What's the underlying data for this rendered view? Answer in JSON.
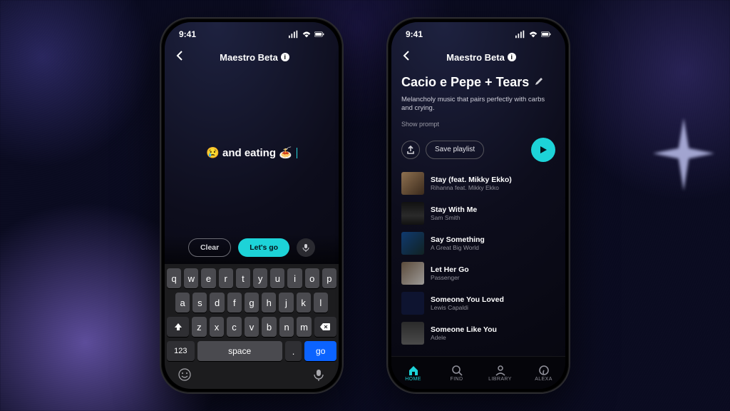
{
  "colors": {
    "accent": "#1dd3d8",
    "bg": "#0a0b20"
  },
  "statusbar": {
    "time": "9:41"
  },
  "nav": {
    "title": "Maestro Beta"
  },
  "phone1": {
    "prompt_text": "and eating",
    "actions": {
      "clear": "Clear",
      "go": "Let's go"
    },
    "keyboard": {
      "row1": [
        "q",
        "w",
        "e",
        "r",
        "t",
        "y",
        "u",
        "i",
        "o",
        "p"
      ],
      "row2": [
        "a",
        "s",
        "d",
        "f",
        "g",
        "h",
        "j",
        "k",
        "l"
      ],
      "row3": [
        "z",
        "x",
        "c",
        "v",
        "b",
        "n",
        "m"
      ],
      "num": "123",
      "space": "space",
      "return": "go"
    }
  },
  "phone2": {
    "playlist_title": "Cacio e Pepe + Tears",
    "playlist_desc": "Melancholy music that pairs perfectly with carbs and crying.",
    "show_prompt": "Show prompt",
    "save_label": "Save playlist",
    "tracks": [
      {
        "title": "Stay (feat. Mikky Ekko)",
        "artist": "Rihanna feat. Mikky Ekko"
      },
      {
        "title": "Stay With Me",
        "artist": "Sam Smith"
      },
      {
        "title": "Say Something",
        "artist": "A Great Big World"
      },
      {
        "title": "Let Her Go",
        "artist": "Passenger"
      },
      {
        "title": "Someone You Loved",
        "artist": "Lewis Capaldi"
      },
      {
        "title": "Someone Like You",
        "artist": "Adele"
      }
    ],
    "tabs": {
      "home": "HOME",
      "find": "FIND",
      "library": "LIBRARY",
      "alexa": "ALEXA"
    }
  }
}
